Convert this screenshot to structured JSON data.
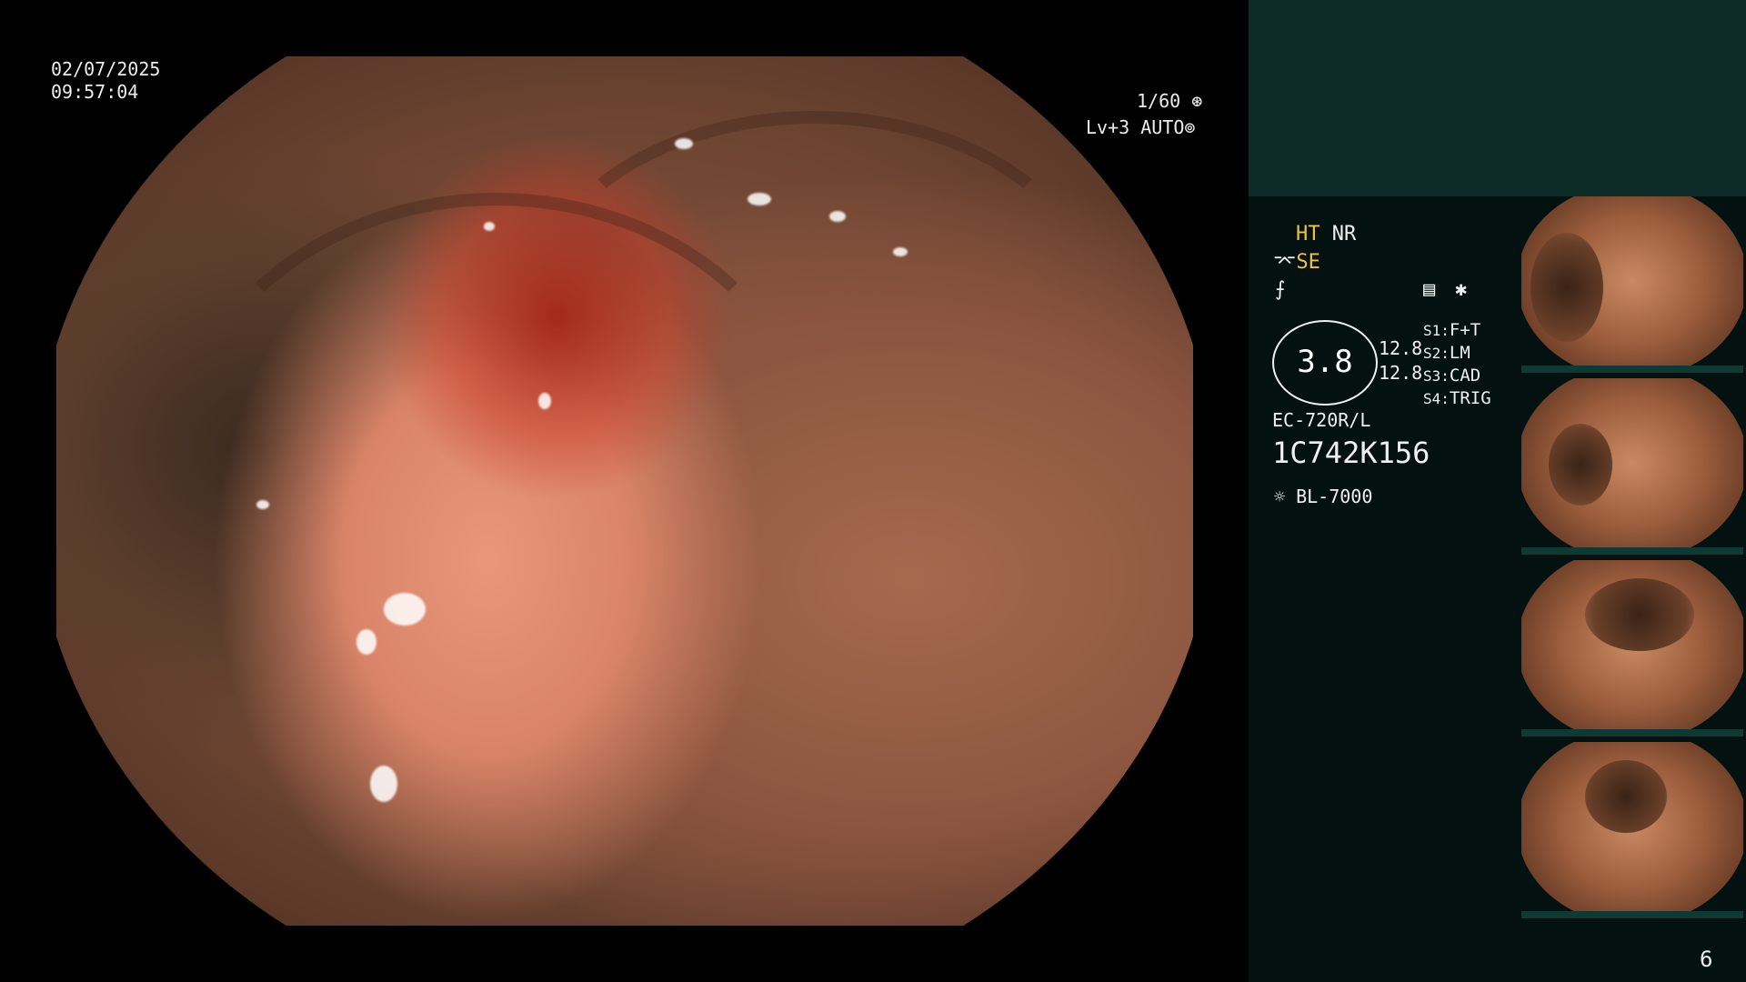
{
  "overlay": {
    "date": "02/07/2025",
    "time": "09:57:04",
    "shutter": "1/60",
    "level": "Lv+3 AUTO"
  },
  "panel": {
    "ht": "HT",
    "nr": "NR",
    "se": "SE",
    "gauge_value": "3.8",
    "readout_1": "12.8",
    "readout_2": "12.8",
    "switches": [
      {
        "key": "S1",
        "value": "F+T"
      },
      {
        "key": "S2",
        "value": "LM"
      },
      {
        "key": "S3",
        "value": "CAD"
      },
      {
        "key": "S4",
        "value": "TRIG"
      }
    ],
    "scope_model": "EC-720R/L",
    "scope_serial": "1C742K156",
    "light_source": "BL-7000",
    "page_number": "6"
  },
  "colors": {
    "panel_bg": "#031210",
    "panel_top_bg": "#0c2a26",
    "accent_yellow": "#f3c33a"
  },
  "icons": {
    "shutter": "aperture-icon",
    "auto": "iris-icon",
    "se": "edge-enhance-icon",
    "color": "color-curve-icon",
    "record": "record-icon",
    "asterisk": "asterisk-icon",
    "light": "lamp-icon"
  }
}
